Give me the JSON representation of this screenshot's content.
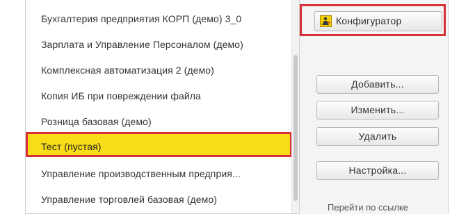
{
  "list": {
    "items": [
      {
        "label": "",
        "selected": false
      },
      {
        "label": "Бухгалтерия предприятия КОРП (демо) 3_0",
        "selected": false
      },
      {
        "label": "Зарплата и Управление Персоналом (демо)",
        "selected": false
      },
      {
        "label": "Комплексная автоматизация 2 (демо)",
        "selected": false
      },
      {
        "label": "Копия ИБ при повреждении файла",
        "selected": false
      },
      {
        "label": "Розница базовая (демо)",
        "selected": false
      },
      {
        "label": "Тест (пустая)",
        "selected": true
      },
      {
        "label": "Управление производственным предприя...",
        "selected": false
      },
      {
        "label": "Управление торговлей базовая (демо)",
        "selected": false
      }
    ]
  },
  "buttons": {
    "configurator": "Конфигуратор",
    "add": "Добавить...",
    "edit": "Изменить...",
    "delete": "Удалить",
    "settings": "Настройка..."
  },
  "footer": {
    "cut_link": "Перейти по ссылке"
  },
  "colors": {
    "highlight_red": "#d9303a",
    "selection_yellow": "#f7dc17"
  }
}
